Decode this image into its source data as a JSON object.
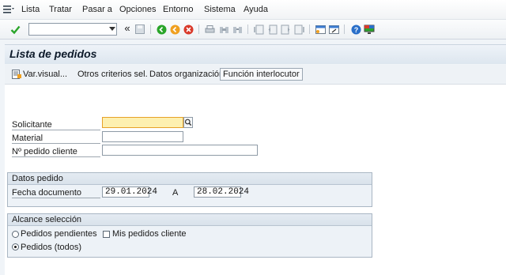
{
  "menu": {
    "items": [
      {
        "label": "Lista"
      },
      {
        "label": "Tratar"
      },
      {
        "label": "Pasar a"
      },
      {
        "label": "Opciones"
      },
      {
        "label": "Entorno"
      },
      {
        "label": "Sistema"
      },
      {
        "label": "Ayuda"
      }
    ]
  },
  "toolbar": {
    "command_value": "",
    "prev_glyph": "«"
  },
  "title": "Lista de pedidos",
  "app_toolbar": {
    "visual_label": "Var.visual...",
    "other_criteria": "Otros criterios sel.",
    "org_data": "Datos organización",
    "partner_function": "Función interlocutor"
  },
  "form": {
    "solicitante_label": "Solicitante",
    "solicitante_value": "",
    "material_label": "Material",
    "material_value": "",
    "customer_po_label": "Nº pedido cliente",
    "customer_po_value": ""
  },
  "order_data": {
    "title": "Datos pedido",
    "date_label": "Fecha documento",
    "date_from": "29.01.2024",
    "to_label": "A",
    "date_to": "28.02.2024"
  },
  "selection_scope": {
    "title": "Alcance selección",
    "pending_label": "Pedidos pendientes",
    "pending_selected": false,
    "my_orders_label": "Mis pedidos cliente",
    "my_orders_checked": false,
    "all_label": "Pedidos (todos)",
    "all_selected": true
  },
  "colors": {
    "accent_required": "#fdf0b0",
    "enter_green": "#2aa52a",
    "exit_orange": "#f0a020",
    "cancel_red": "#d93a2b",
    "help_blue": "#2a6fc9"
  }
}
